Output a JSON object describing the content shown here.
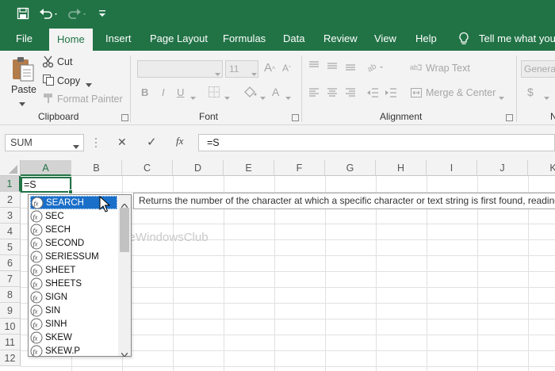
{
  "qat": {
    "save_icon": "save-icon",
    "undo_icon": "undo-icon",
    "redo_icon": "redo-icon",
    "customize_icon": "customize-qat-icon"
  },
  "tabs": [
    "File",
    "Home",
    "Insert",
    "Page Layout",
    "Formulas",
    "Data",
    "Review",
    "View",
    "Help"
  ],
  "tell_me": "Tell me what you w",
  "ribbon": {
    "clipboard": {
      "paste": "Paste",
      "cut": "Cut",
      "copy": "Copy",
      "format_painter": "Format Painter",
      "label": "Clipboard"
    },
    "font": {
      "size": "11",
      "bold": "B",
      "italic": "I",
      "underline": "U",
      "label": "Font"
    },
    "alignment": {
      "wrap_text": "Wrap Text",
      "merge_center": "Merge & Center",
      "label": "Alignment"
    },
    "number": {
      "format": "General",
      "currency": "$",
      "label": "N"
    }
  },
  "formula_bar": {
    "name_box": "SUM",
    "cancel": "✕",
    "enter": "✓",
    "fx": "fx",
    "value": "=S"
  },
  "grid": {
    "columns": [
      "A",
      "B",
      "C",
      "D",
      "E",
      "F",
      "G",
      "H",
      "I",
      "J",
      "K"
    ],
    "rows": [
      "1",
      "2",
      "3",
      "4",
      "5",
      "6",
      "7",
      "8",
      "9",
      "10",
      "11",
      "12"
    ],
    "active_cell_value": "=S"
  },
  "autocomplete": {
    "items": [
      "SEARCH",
      "SEC",
      "SECH",
      "SECOND",
      "SERIESSUM",
      "SHEET",
      "SHEETS",
      "SIGN",
      "SIN",
      "SINH",
      "SKEW",
      "SKEW.P"
    ],
    "selected_index": 0,
    "tooltip": "Returns the number of the character at which a specific character or text string is first found, reading"
  },
  "watermark": "TheWindowsClub",
  "colors": {
    "brand": "#217346",
    "selection": "#1a6fc9"
  }
}
